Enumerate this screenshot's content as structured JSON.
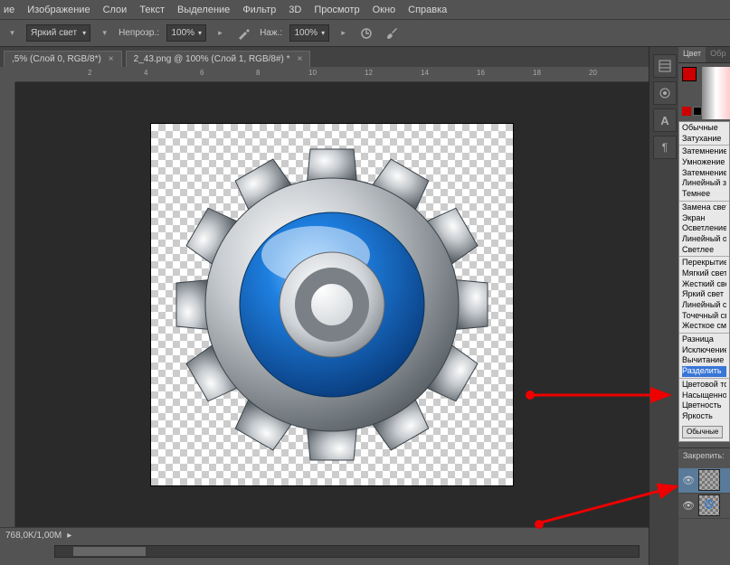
{
  "menubar": [
    "ие",
    "Изображение",
    "Слои",
    "Текст",
    "Выделение",
    "Фильтр",
    "3D",
    "Просмотр",
    "Окно",
    "Справка"
  ],
  "options": {
    "blend_mode": "Яркий свет",
    "opacity_label": "Непрозр.:",
    "opacity_val": "100%",
    "fill_label": "Наж.:",
    "fill_val": "100%"
  },
  "tabs": [
    {
      "label": ",5% (Слой 0, RGB/8*)"
    },
    {
      "label": "2_43.png @ 100% (Слой 1, RGB/8#) *"
    }
  ],
  "ruler_ticks": [
    "2",
    "4",
    "6",
    "8",
    "10",
    "12",
    "14",
    "16",
    "18",
    "20"
  ],
  "panels": {
    "color_tab": "Цвет",
    "sample_tab": "Обр",
    "blend_modes": [
      [
        "Обычные",
        "Затухание"
      ],
      [
        "Затемнение",
        "Умножение",
        "Затемнение о",
        "Линейный за",
        "Темнее"
      ],
      [
        "Замена светл",
        "Экран",
        "Осветление",
        "Линейный ос",
        "Светлее"
      ],
      [
        "Перекрытие",
        "Мягкий свет",
        "Жесткий све",
        "Яркий свет",
        "Линейный св",
        "Точечный св",
        "Жесткое сме"
      ],
      [
        "Разница",
        "Исключение",
        "Вычитание",
        "Разделить"
      ],
      [
        "Цветовой то",
        "Насыщеннос",
        "Цветность",
        "Яркость"
      ]
    ],
    "blend_normal_btn": "Обычные",
    "lock_label": "Закрепить:"
  },
  "status": {
    "doc_size": "768,0K/1,00M"
  }
}
